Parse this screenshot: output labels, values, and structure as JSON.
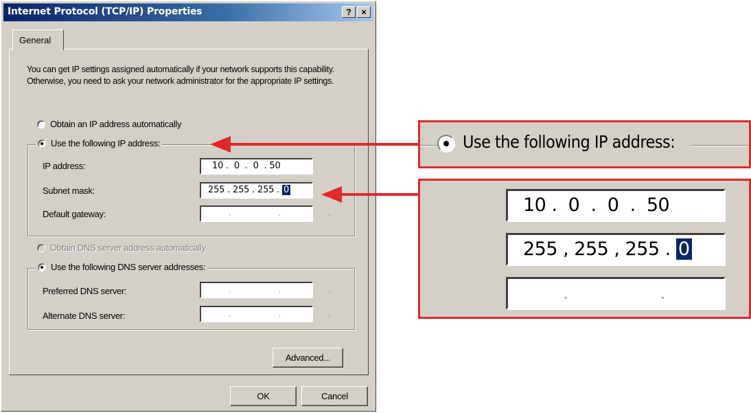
{
  "dialog": {
    "title": "Internet Protocol (TCP/IP) Properties",
    "help_button": "?",
    "close_button": "×",
    "tab": "General",
    "description": "You can get IP settings assigned automatically if your network supports this capability. Otherwise, you need to ask your network administrator for the appropriate IP settings.",
    "ip_mode": {
      "auto_label": "Obtain an IP address automatically",
      "manual_label": "Use the following IP address:",
      "selected": "manual"
    },
    "ip_fields": {
      "ip_label": "IP address:",
      "ip_value": "10 .  0  .  0  . 50",
      "subnet_label": "Subnet mask:",
      "subnet_value": "255 . 255 . 255 .",
      "subnet_last_octet": "0",
      "gateway_label": "Default gateway:",
      "gateway_dots": ". . ."
    },
    "dns_mode": {
      "auto_label": "Obtain DNS server address automatically",
      "manual_label": "Use the following DNS server addresses:",
      "auto_disabled": true
    },
    "dns_fields": {
      "preferred_label": "Preferred DNS server:",
      "alternate_label": "Alternate DNS server:",
      "dots": ". . ."
    },
    "advanced_button": "Advanced...",
    "ok_button": "OK",
    "cancel_button": "Cancel"
  },
  "callouts": {
    "radio_zoom_label": "Use the following IP address:",
    "ip_zoom_value": "10 .  0  .  0  .  50",
    "subnet_zoom_value": "255 , 255 , 255 .",
    "subnet_zoom_last_octet": "0",
    "gateway_zoom_dots": ". . ."
  },
  "colors": {
    "annotation_red": "#dd2a2a",
    "dialog_gray": "#d4d0c8",
    "title_blue": "#0a246a",
    "selection_blue": "#0a246a"
  }
}
